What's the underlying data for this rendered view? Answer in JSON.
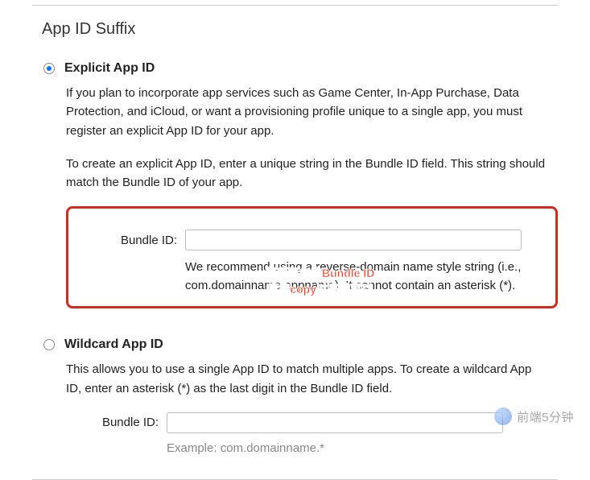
{
  "section_title": "App ID Suffix",
  "options": {
    "explicit": {
      "label": "Explicit App ID",
      "selected": true,
      "desc1": "If you plan to incorporate app services such as Game Center, In-App Purchase, Data Protection, and iCloud, or want a provisioning profile unique to a single app, you must register an explicit App ID for your app.",
      "desc2": "To create an explicit App ID, enter a unique string in the Bundle ID field. This string should match the Bundle ID of your app.",
      "bundle_label": "Bundle ID:",
      "bundle_value": "",
      "bundle_hint": "We recommend using a reverse-domain name style string (i.e., com.domainname.appname). It cannot contain an asterisk (*)."
    },
    "wildcard": {
      "label": "Wildcard App ID",
      "selected": false,
      "desc1": "This allows you to use a single App ID to match multiple apps. To create a wildcard App ID, enter an asterisk (*) as the last digit in the Bundle ID field.",
      "bundle_label": "Bundle ID:",
      "bundle_value": "",
      "example": "Example: com.domainname.*"
    }
  },
  "annotation": {
    "line1": "将项目中的Bundle ID",
    "line2": "直接copy过来就可以"
  },
  "watermark": "前端5分钟"
}
